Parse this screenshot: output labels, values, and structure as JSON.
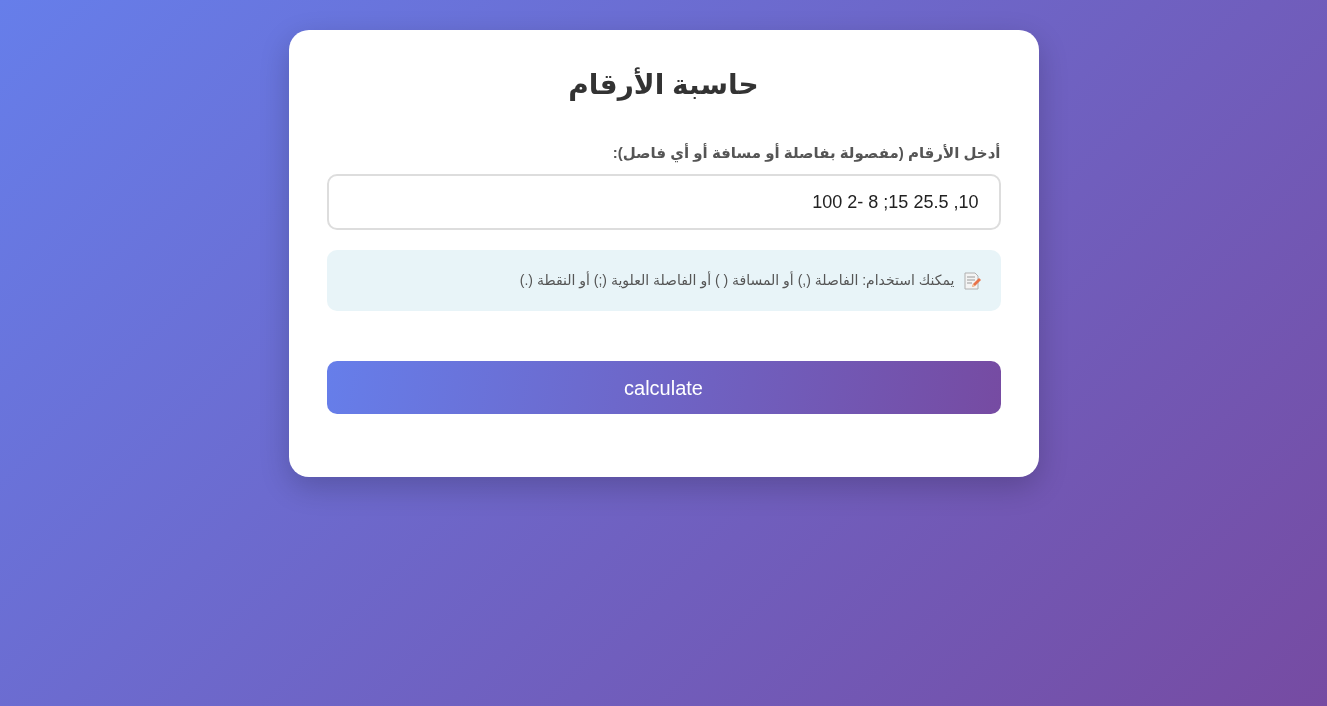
{
  "title": "حاسبة الأرقام",
  "input": {
    "label": "أدخل الأرقام (مفصولة بفاصلة أو مسافة أو أي فاصل):",
    "value": "10, 25.5 15; 8 -2 100"
  },
  "hint": {
    "text": "يمكنك استخدام: الفاصلة (,) أو المسافة ( ) أو الفاصلة العلوية (;) أو النقطة (.)"
  },
  "button": {
    "label": "calculate"
  }
}
